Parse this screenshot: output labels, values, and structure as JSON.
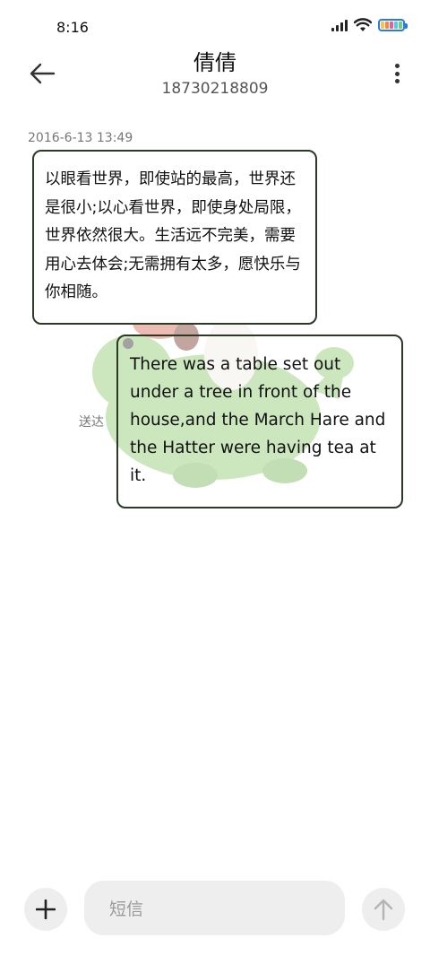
{
  "status": {
    "time": "8:16",
    "icons": [
      "signal-icon",
      "wifi-icon",
      "battery-icon"
    ]
  },
  "header": {
    "title": "倩倩",
    "subtitle": "18730218809",
    "back_icon": "arrow-left-icon",
    "more_icon": "more-vertical-icon"
  },
  "conversation": {
    "timestamp": "2016-6-13 13:49",
    "incoming": {
      "text": "以眼看世界，即使站的最高，世界还是很小;以心看世界，即使身处局限，世界依然很大。生活远不完美，需要用心去体会;无需拥有太多，愿快乐与你相随。"
    },
    "outgoing": {
      "text": "There was a table set out under a tree in front of the house,and the March Hare and the Hatter were having tea at it.",
      "status": "送达"
    }
  },
  "composer": {
    "placeholder": "短信",
    "add_icon": "plus-icon",
    "send_icon": "arrow-up-icon"
  },
  "colors": {
    "bubble_border": "#2b3a24",
    "composer_bg": "#eeeeee",
    "sticker_green": "#8fc96f"
  }
}
